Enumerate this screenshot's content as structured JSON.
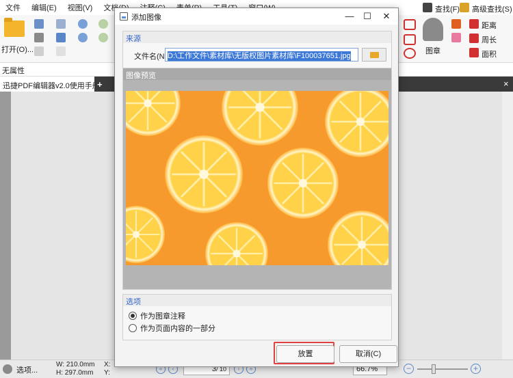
{
  "app": {
    "menu": [
      "文件",
      "编辑(E)",
      "视图(V)",
      "文档(D)",
      "注释(C)",
      "表单(R)",
      "工具(T)",
      "窗口(W)"
    ],
    "open_label": "打开(O)...",
    "property_bar": "无属性",
    "doc_tab": "迅捷PDF编辑器v2.0使用手册",
    "ribbon_right": {
      "find": "查找(F)",
      "advanced_find": "高级查找(S)",
      "stamp": "图章",
      "distance": "距离",
      "perimeter": "周长",
      "area": "面积"
    },
    "status": {
      "select_tool": "选项...",
      "width": "W: 210.0mm",
      "height": "H: 297.0mm",
      "x": "X:",
      "y": "Y:",
      "page": "3",
      "total": "/ 10",
      "zoom": "66.7%"
    }
  },
  "dialog": {
    "title": "添加图像",
    "source_group": "来源",
    "filename_label": "文件名(N):",
    "filename_value": "D:\\工作文件\\素材库\\无版权图片素材库\\F100037651.jpg",
    "preview_group": "图像预览",
    "options_group": "选项",
    "option_stamp": "作为图章注释",
    "option_page_content": "作为页面内容的一部分",
    "selected_option": "作为图章注释",
    "place_button": "放置",
    "cancel_button": "取消(C)"
  },
  "colors": {
    "orange_bg": "#f79a2e",
    "accent_blue": "#3c78d8",
    "highlight_red": "#e04040"
  }
}
